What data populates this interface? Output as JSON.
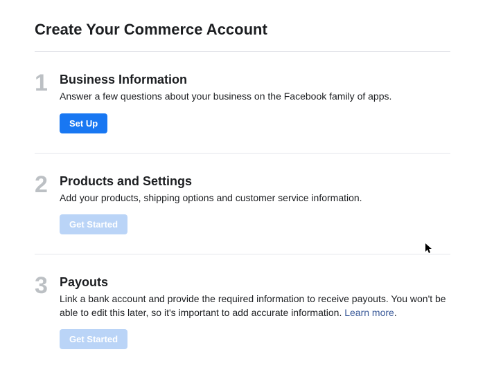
{
  "page_title": "Create Your Commerce Account",
  "steps": [
    {
      "number": "1",
      "title": "Business Information",
      "desc": "Answer a few questions about your business on the Facebook family of apps.",
      "button_label": "Set Up",
      "button_enabled": true
    },
    {
      "number": "2",
      "title": "Products and Settings",
      "desc": "Add your products, shipping options and customer service information.",
      "button_label": "Get Started",
      "button_enabled": false
    },
    {
      "number": "3",
      "title": "Payouts",
      "desc_prefix": "Link a bank account and provide the required information to receive payouts. You won't be able to edit this later, so it's important to add accurate information. ",
      "link_text": "Learn more",
      "desc_suffix": ".",
      "button_label": "Get Started",
      "button_enabled": false
    }
  ]
}
